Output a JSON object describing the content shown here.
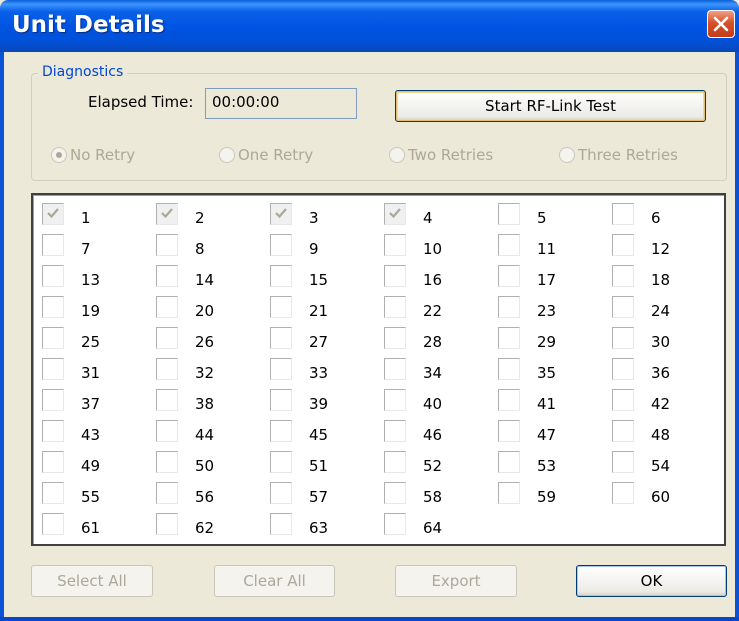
{
  "window": {
    "title": "Unit Details"
  },
  "diagnostics": {
    "group_label": "Diagnostics",
    "elapsed_label": "Elapsed Time:",
    "elapsed_value": "00:00:00",
    "start_button": "Start RF-Link Test",
    "retry_options": [
      {
        "label": "No Retry",
        "selected": true,
        "enabled": false
      },
      {
        "label": "One Retry",
        "selected": false,
        "enabled": false
      },
      {
        "label": "Two Retries",
        "selected": false,
        "enabled": false
      },
      {
        "label": "Three Retries",
        "selected": false,
        "enabled": false
      }
    ]
  },
  "units": {
    "labels": [
      "1",
      "2",
      "3",
      "4",
      "5",
      "6",
      "7",
      "8",
      "9",
      "10",
      "11",
      "12",
      "13",
      "14",
      "15",
      "16",
      "17",
      "18",
      "19",
      "20",
      "21",
      "22",
      "23",
      "24",
      "25",
      "26",
      "27",
      "28",
      "29",
      "30",
      "31",
      "32",
      "33",
      "34",
      "35",
      "36",
      "37",
      "38",
      "39",
      "40",
      "41",
      "42",
      "43",
      "44",
      "45",
      "46",
      "47",
      "48",
      "49",
      "50",
      "51",
      "52",
      "53",
      "54",
      "55",
      "56",
      "57",
      "58",
      "59",
      "60",
      "61",
      "62",
      "63",
      "64"
    ],
    "checked": [
      "1",
      "2",
      "3",
      "4"
    ],
    "disabled_checked": true
  },
  "buttons": {
    "select_all": "Select All",
    "clear_all": "Clear All",
    "export": "Export",
    "ok": "OK"
  },
  "colors": {
    "titlebar": "#0054e3",
    "group_label": "#0046d5",
    "dialog_bg": "#ece9d8",
    "disabled_text": "#aca899"
  }
}
